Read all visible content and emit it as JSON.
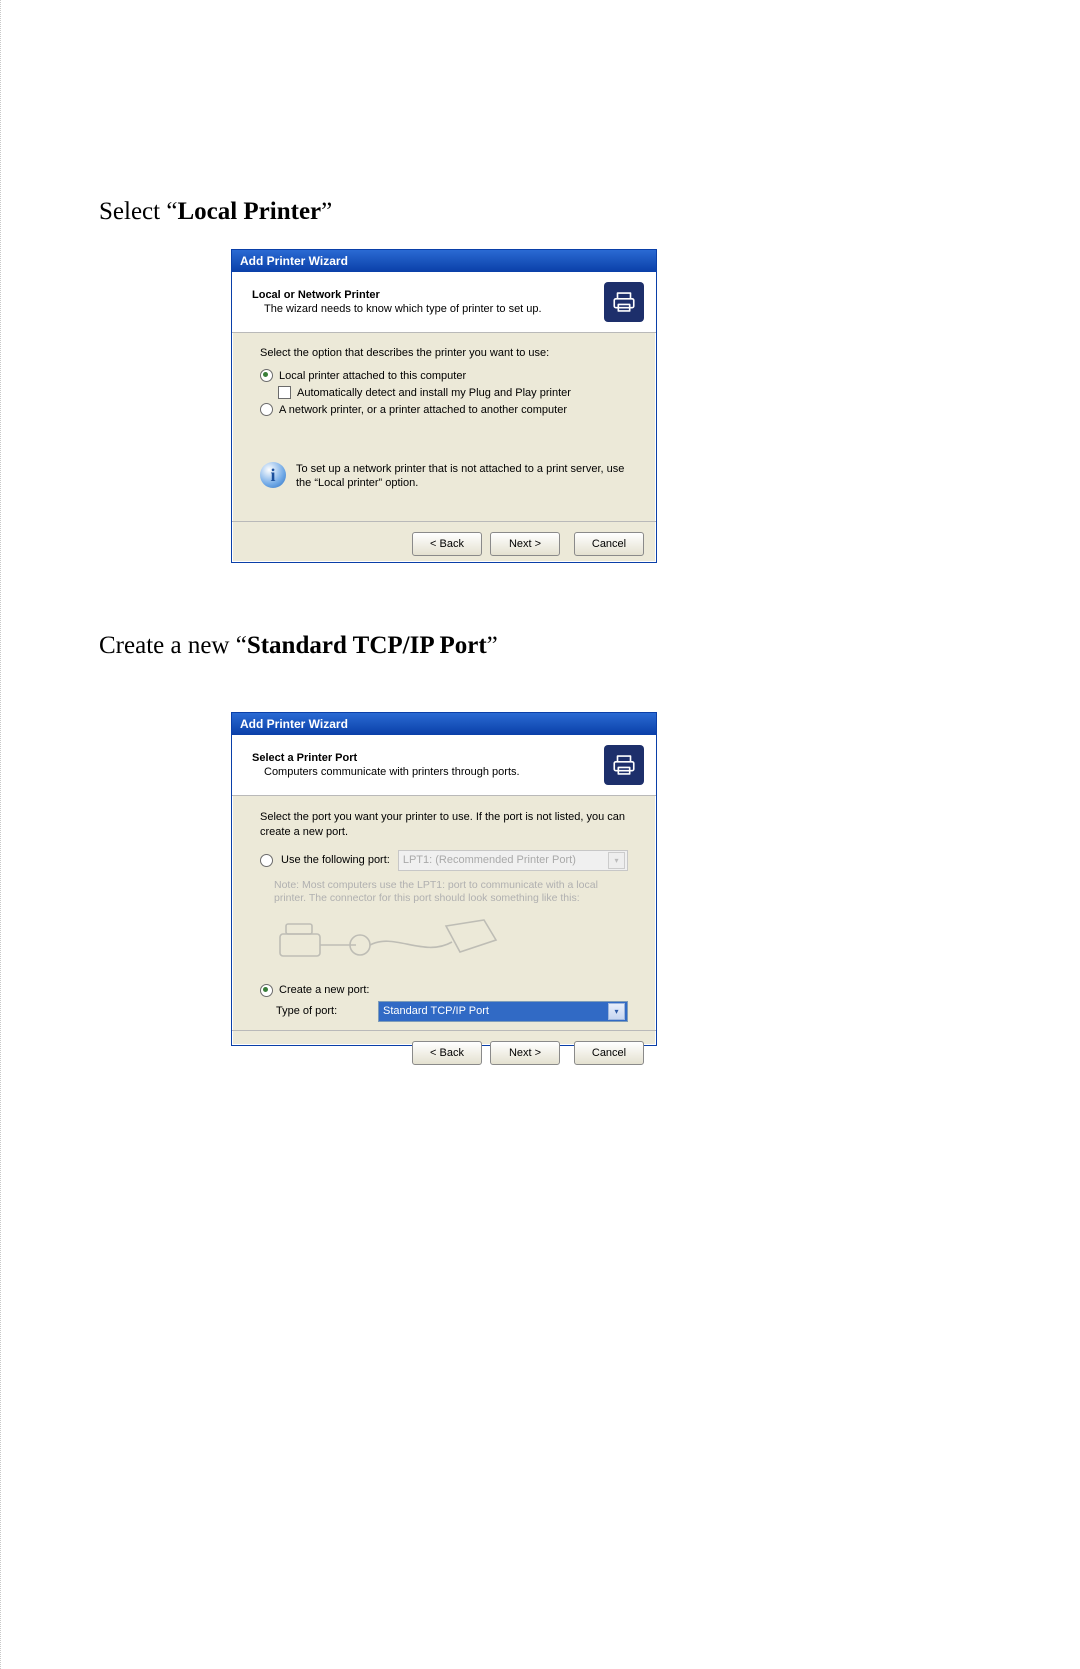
{
  "caption1_pre": "Select “",
  "caption1_b": "Local Printer",
  "caption1_post": "”",
  "caption2_pre": "Create a new “",
  "caption2_b": "Standard TCP/IP Port",
  "caption2_post": "”",
  "dlg1": {
    "title": "Add Printer Wizard",
    "heading": "Local or Network Printer",
    "subheading": "The wizard needs to know which type of printer to set up.",
    "prompt": "Select the option that describes the printer you want to use:",
    "opt_local": "Local printer attached to this computer",
    "opt_auto": "Automatically detect and install my Plug and Play printer",
    "opt_network": "A network printer, or a printer attached to another computer",
    "info": "To set up a network printer that is not attached to a print server, use the “Local printer” option.",
    "back": "< Back",
    "next": "Next >",
    "cancel": "Cancel"
  },
  "dlg2": {
    "title": "Add Printer Wizard",
    "heading": "Select a Printer Port",
    "subheading": "Computers communicate with printers through ports.",
    "prompt": "Select the port you want your printer to use.  If the port is not listed, you can create a new port.",
    "opt_use": "Use the following port:",
    "port_disabled": "LPT1: (Recommended Printer Port)",
    "note": "Note: Most computers use the LPT1: port to communicate with a local printer. The connector for this port should look something like this:",
    "opt_create": "Create a new port:",
    "type_label": "Type of port:",
    "type_value": "Standard TCP/IP Port",
    "back": "< Back",
    "next": "Next >",
    "cancel": "Cancel"
  }
}
